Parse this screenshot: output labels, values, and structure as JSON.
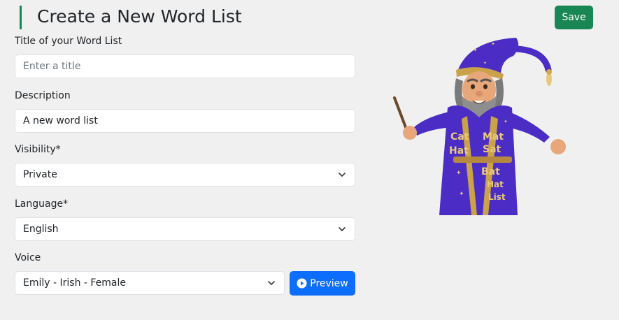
{
  "header": {
    "title": "Create a New Word List",
    "save_label": "Save"
  },
  "form": {
    "title_label": "Title of your Word List",
    "title_placeholder": "Enter a title",
    "title_value": "",
    "description_label": "Description",
    "description_value": "A new word list",
    "visibility_label": "Visibility*",
    "visibility_value": "Private",
    "language_label": "Language*",
    "language_value": "English",
    "voice_label": "Voice",
    "voice_value": "Emily - Irish - Female",
    "preview_label": "Preview"
  },
  "illustration": {
    "robe_words": [
      "Cat",
      "Mat",
      "Hat",
      "Sat",
      "Bat",
      "Hat",
      "List"
    ]
  },
  "colors": {
    "accent_green": "#198754",
    "primary_blue": "#0d6efd",
    "robe_purple": "#4b2cc4"
  },
  "icons": {
    "save": "none",
    "preview": "play-circle-icon",
    "select": "chevron-down-icon"
  }
}
